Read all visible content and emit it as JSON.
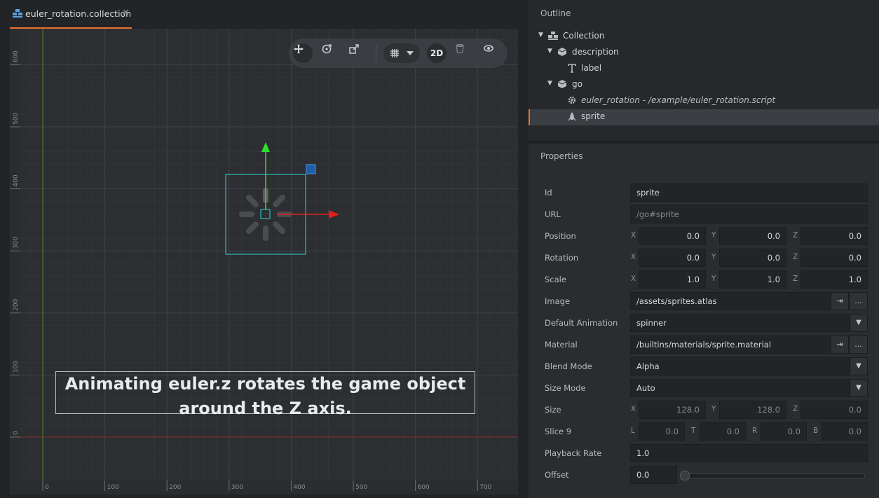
{
  "tab": {
    "title": "euler_rotation.collection",
    "close": "✕"
  },
  "viewport": {
    "caption_line1": "Animating euler.z rotates the game object",
    "caption_line2": "around the Z axis.",
    "x_ticks": [
      "0",
      "100",
      "200",
      "300",
      "400",
      "500",
      "600",
      "700"
    ],
    "y_ticks": [
      "600",
      "500",
      "400",
      "300",
      "200",
      "100",
      "0"
    ],
    "toolbar": {
      "mode": "2D"
    }
  },
  "outline": {
    "title": "Outline",
    "items": [
      {
        "label": "Collection",
        "icon": "collection-icon"
      },
      {
        "label": "description",
        "icon": "game-object-icon"
      },
      {
        "label": "label",
        "icon": "text-icon"
      },
      {
        "label": "go",
        "icon": "game-object-icon"
      },
      {
        "label": "euler_rotation - /example/euler_rotation.script",
        "icon": "script-gear-icon"
      },
      {
        "label": "sprite",
        "icon": "sprite-icon",
        "selected": true
      }
    ]
  },
  "properties": {
    "title": "Properties",
    "id": {
      "label": "Id",
      "value": "sprite"
    },
    "url": {
      "label": "URL",
      "value": "/go#sprite"
    },
    "position": {
      "label": "Position",
      "x": "0.0",
      "y": "0.0",
      "z": "0.0"
    },
    "rotation": {
      "label": "Rotation",
      "x": "0.0",
      "y": "0.0",
      "z": "0.0"
    },
    "scale": {
      "label": "Scale",
      "x": "1.0",
      "y": "1.0",
      "z": "1.0"
    },
    "image": {
      "label": "Image",
      "value": "/assets/sprites.atlas"
    },
    "default_animation": {
      "label": "Default Animation",
      "value": "spinner"
    },
    "material": {
      "label": "Material",
      "value": "/builtins/materials/sprite.material"
    },
    "blend_mode": {
      "label": "Blend Mode",
      "value": "Alpha"
    },
    "size_mode": {
      "label": "Size Mode",
      "value": "Auto"
    },
    "size": {
      "label": "Size",
      "x": "128.0",
      "y": "128.0",
      "z": "0.0"
    },
    "slice9": {
      "label": "Slice 9",
      "l": "0.0",
      "t": "0.0",
      "r": "0.0",
      "b": "0.0"
    },
    "playback_rate": {
      "label": "Playback Rate",
      "value": "1.0"
    },
    "offset": {
      "label": "Offset",
      "value": "0.0"
    },
    "axis_labels": {
      "x": "X",
      "y": "Y",
      "z": "Z",
      "l": "L",
      "t": "T",
      "r": "R",
      "b": "B"
    },
    "goto_glyph": "⇥",
    "browse_glyph": "...",
    "dropdown_glyph": "▼"
  },
  "colors": {
    "accent": "#e8732c",
    "selection_cyan": "#2fd6e0",
    "axis_x": "#e02020",
    "axis_y": "#2ee02e",
    "origin_y_line": "#4f8a2a",
    "origin_x_line": "#8a2f2f"
  }
}
